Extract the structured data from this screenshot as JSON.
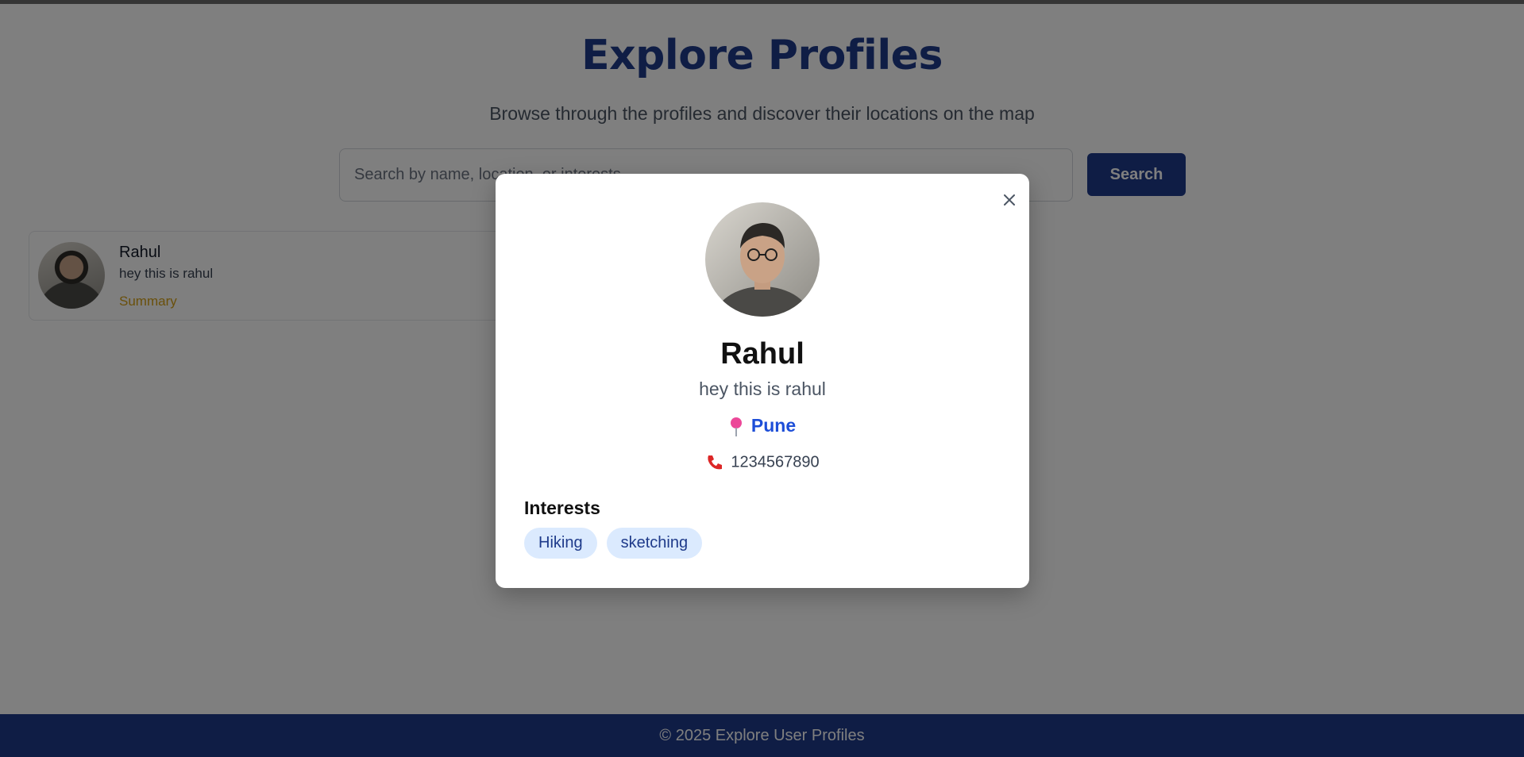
{
  "header": {
    "title": "Explore Profiles",
    "subtitle": "Browse through the profiles and discover their locations on the map"
  },
  "search": {
    "placeholder": "Search by name, location, or interests",
    "value": "",
    "button_label": "Search"
  },
  "profiles": [
    {
      "name": "Rahul",
      "bio": "hey this is rahul",
      "link_label": "Summary"
    }
  ],
  "modal": {
    "name": "Rahul",
    "bio": "hey this is rahul",
    "location": "Pune",
    "phone": "1234567890",
    "interests_title": "Interests",
    "interests": [
      "Hiking",
      "sketching"
    ],
    "close_icon": "close-icon"
  },
  "footer": {
    "text": "© 2025 Explore User Profiles"
  },
  "colors": {
    "brand": "#1e3a8a",
    "summary_link": "#d4a017",
    "location": "#1d4ed8",
    "tag_bg": "#dbeafe",
    "pin": "#ec4899",
    "phone": "#dc2626"
  }
}
